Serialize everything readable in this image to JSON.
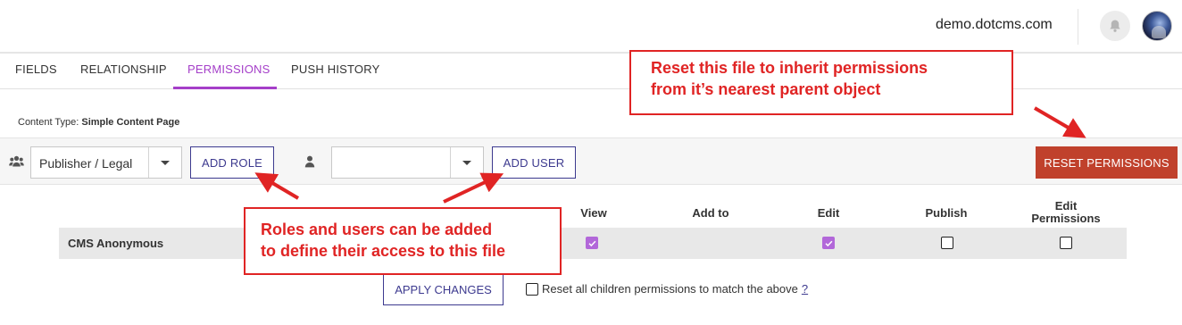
{
  "header": {
    "site_name": "demo.dotcms.com",
    "bell_icon": "bell-icon",
    "avatar_icon": "user-avatar"
  },
  "tabs": [
    {
      "label": "FIELDS",
      "active": false
    },
    {
      "label": "RELATIONSHIP",
      "active": false
    },
    {
      "label": "PERMISSIONS",
      "active": true
    },
    {
      "label": "PUSH HISTORY",
      "active": false
    }
  ],
  "content_type": {
    "label": "Content Type:",
    "value": "Simple Content Page"
  },
  "toolbar": {
    "roles_icon": "users-group-icon",
    "role_select_value": "Publisher / Legal",
    "add_role_label": "ADD ROLE",
    "user_icon": "user-icon",
    "user_select_value": "",
    "add_user_label": "ADD USER",
    "reset_permissions_label": "RESET PERMISSIONS"
  },
  "table": {
    "columns": [
      "View",
      "Add to",
      "Edit",
      "Publish",
      "Edit Permissions"
    ],
    "rows": [
      {
        "name": "CMS Anonymous",
        "view": true,
        "add_to": null,
        "edit": true,
        "publish": false,
        "edit_permissions": false
      }
    ]
  },
  "apply_changes_label": "APPLY CHANGES",
  "reset_children": {
    "label": "Reset all children permissions to match the above",
    "help_link": "?"
  },
  "callouts": {
    "reset_line1": "Reset this file to inherit permissions",
    "reset_line2": "from it’s nearest parent object",
    "roles_line1": "Roles and users can be added",
    "roles_line2": "to define their access to this file"
  },
  "colors": {
    "accent_purple": "#a53fc9",
    "button_navy": "#3d3a8f",
    "reset_red": "#c0412c",
    "callout_red": "#e02424",
    "checkbox_purple": "#b267d9"
  }
}
